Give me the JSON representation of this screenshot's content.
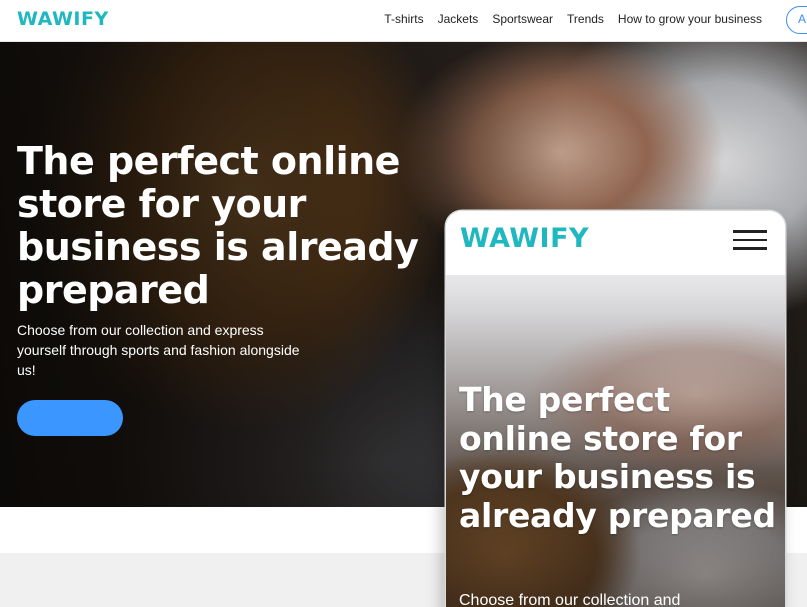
{
  "header": {
    "logo": "WAWIFY",
    "nav": [
      "T-shirts",
      "Jackets",
      "Sportswear",
      "Trends",
      "How to grow your business"
    ],
    "login_label": "A"
  },
  "hero": {
    "title": "The perfect online store for your business is already prepared",
    "subtitle": "Choose from our collection and express yourself through sports and fashion alongside us!",
    "cta_label": ""
  },
  "mobile": {
    "logo": "WAWIFY",
    "title": "The perfect online store for your business is already prepared",
    "subtitle": "Choose from our collection and"
  },
  "colors": {
    "brand": "#1fb8c1",
    "accent": "#3b96ff",
    "nav_text": "#222222"
  },
  "icons": {
    "menu": "hamburger-icon"
  }
}
